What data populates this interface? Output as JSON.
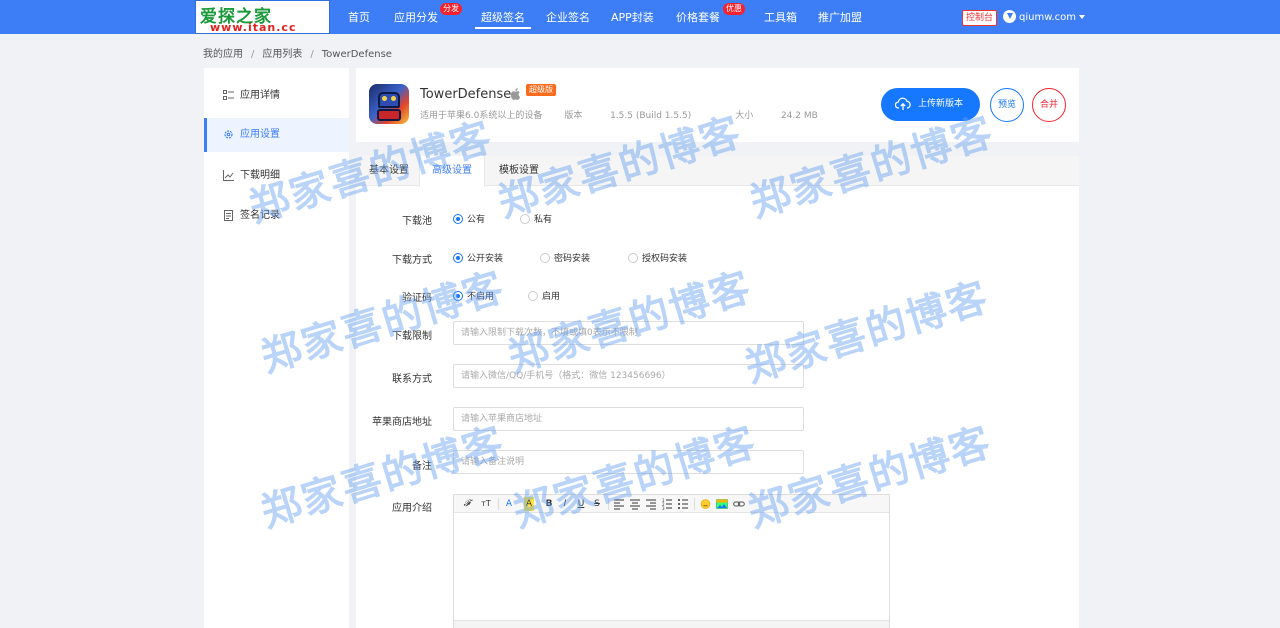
{
  "brand": {
    "logo_line1": "爱探之家",
    "logo_line2": "www.itan.cc"
  },
  "nav": {
    "items": [
      {
        "label": "首页"
      },
      {
        "label": "应用分发",
        "badge": "分发"
      },
      {
        "label": "超级签名"
      },
      {
        "label": "企业签名"
      },
      {
        "label": "APP封装"
      },
      {
        "label": "价格套餐",
        "badge": "优惠"
      },
      {
        "label": "工具箱"
      },
      {
        "label": "推广加盟"
      }
    ],
    "active": "超级签名",
    "console_label": "控制台",
    "username": "qiumw.com"
  },
  "breadcrumb": [
    "我的应用",
    "应用列表",
    "TowerDefense"
  ],
  "sidebar": {
    "items": [
      {
        "label": "应用详情",
        "icon": "list-icon"
      },
      {
        "label": "应用设置",
        "icon": "gear-icon"
      },
      {
        "label": "下载明细",
        "icon": "chart-icon"
      },
      {
        "label": "签名记录",
        "icon": "document-icon"
      }
    ],
    "active": "应用设置"
  },
  "app": {
    "name": "TowerDefense",
    "platform_icon": "apple-icon",
    "tag": "超级版",
    "compat": "适用于苹果6.0系统以上的设备",
    "version_label": "版本",
    "version": "1.5.5 (Build 1.5.5)",
    "size_label": "大小",
    "size": "24.2 MB"
  },
  "actions": {
    "upload": "上传新版本",
    "preview": "预览",
    "merge": "合并"
  },
  "tabs": [
    {
      "label": "基本设置"
    },
    {
      "label": "高级设置"
    },
    {
      "label": "模板设置"
    }
  ],
  "active_tab": "高级设置",
  "form": {
    "download_pool": {
      "label": "下载池",
      "options": [
        "公有",
        "私有"
      ],
      "selected": "公有"
    },
    "download_mode": {
      "label": "下载方式",
      "options": [
        "公开安装",
        "密码安装",
        "授权码安装"
      ],
      "selected": "公开安装"
    },
    "captcha": {
      "label": "验证码",
      "options": [
        "不启用",
        "启用"
      ],
      "selected": "不启用"
    },
    "download_limit": {
      "label": "下载限制",
      "value": "",
      "placeholder": "请输入限制下载次数，不填或填0表示不限制"
    },
    "contact": {
      "label": "联系方式",
      "value": "",
      "placeholder": "请输入微信/QQ/手机号（格式：微信 123456696）"
    },
    "appstore_url": {
      "label": "苹果商店地址",
      "value": "",
      "placeholder": "请输入苹果商店地址"
    },
    "remark": {
      "label": "备注",
      "value": "",
      "placeholder": "请输入备注说明"
    },
    "intro": {
      "label": "应用介绍"
    }
  },
  "editor_toolbar": [
    "𝓕",
    "ᴛT",
    "A",
    "A",
    "B",
    "I",
    "U",
    "S"
  ],
  "watermark": "郑家喜的博客",
  "colors": {
    "primary": "#3d7ef6",
    "danger": "#f5222d",
    "tag": "#fa6b1d"
  }
}
